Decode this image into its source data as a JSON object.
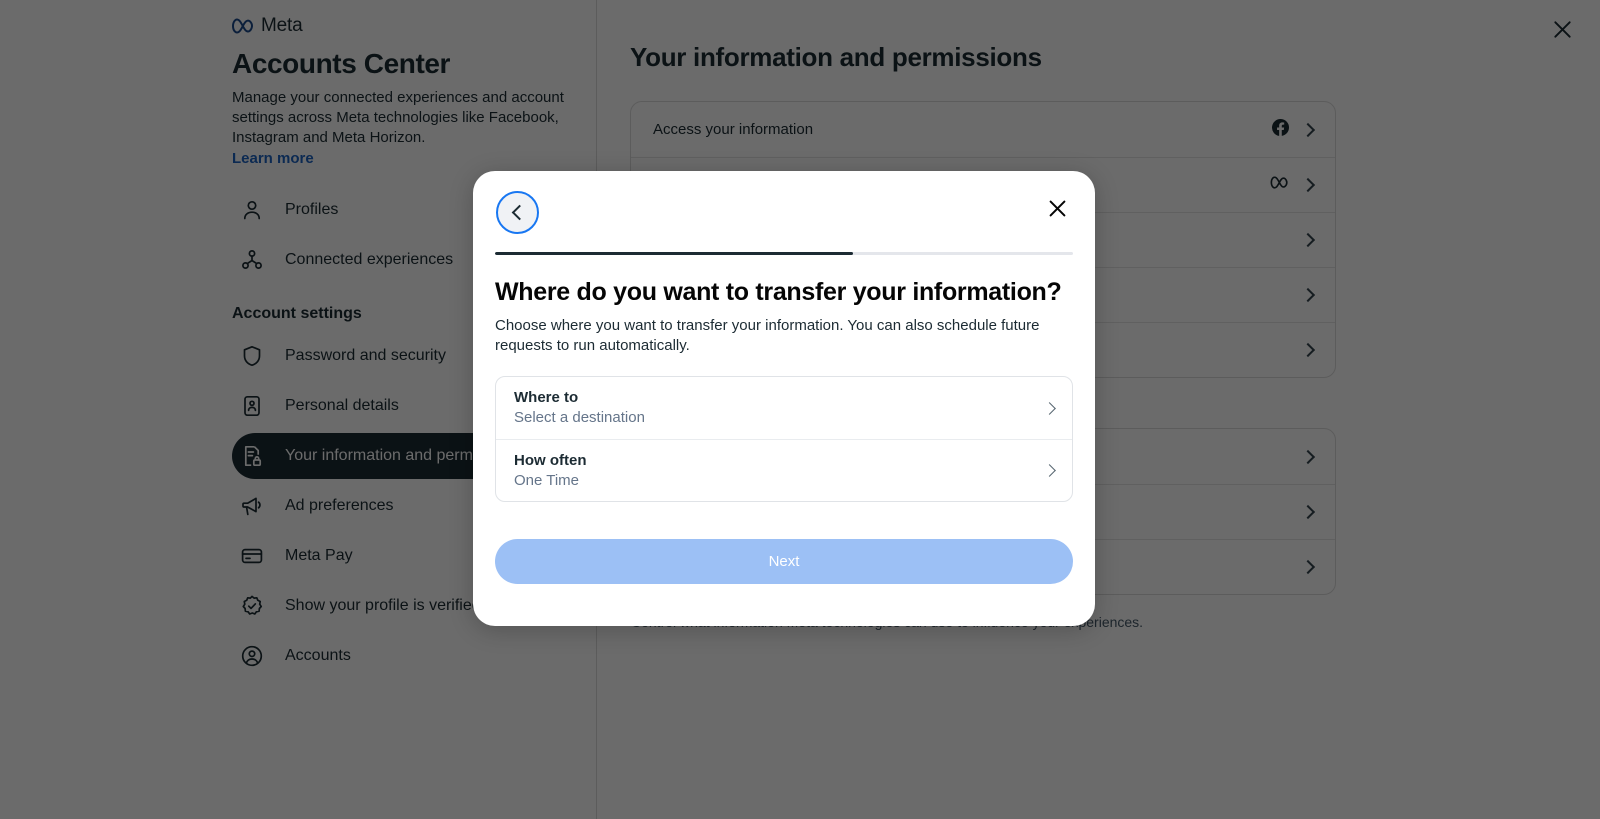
{
  "brand": {
    "wordmark": "Meta",
    "logo_icon": "meta-infinity-icon"
  },
  "sidebar": {
    "title": "Accounts Center",
    "description": "Manage your connected experiences and account settings across Meta technologies like Facebook, Instagram and Meta Horizon.",
    "learn_more": "Learn more",
    "section_title": "Account settings",
    "items": [
      {
        "label": "Profiles",
        "icon": "person-icon",
        "active": false
      },
      {
        "label": "Connected experiences",
        "icon": "connected-nodes-icon",
        "active": false
      }
    ],
    "settings_items": [
      {
        "label": "Password and security",
        "icon": "shield-icon",
        "active": false
      },
      {
        "label": "Personal details",
        "icon": "id-card-icon",
        "active": false
      },
      {
        "label": "Your information and permissions",
        "icon": "document-lock-icon",
        "active": true
      },
      {
        "label": "Ad preferences",
        "icon": "megaphone-icon",
        "active": false
      },
      {
        "label": "Meta Pay",
        "icon": "credit-card-icon",
        "active": false
      },
      {
        "label": "Show your profile is verified",
        "icon": "verified-badge-icon",
        "active": false
      },
      {
        "label": "Accounts",
        "icon": "account-circle-icon",
        "active": false
      }
    ]
  },
  "content": {
    "title": "Your information and permissions",
    "cards": [
      {
        "rows": [
          {
            "label": "Access your information",
            "badge_icon": "facebook-icon"
          },
          {
            "label": "",
            "badge_icon": "meta-infinity-icon"
          },
          {
            "label": "",
            "badge_icon": ""
          },
          {
            "label": "",
            "badge_icon": ""
          },
          {
            "label": "",
            "badge_icon": ""
          }
        ]
      },
      {
        "rows": [
          {
            "label": "",
            "badge_icon": ""
          },
          {
            "label": "",
            "badge_icon": ""
          },
          {
            "label": "",
            "badge_icon": ""
          }
        ],
        "caption": "Control what information Meta technologies can use to influence your experiences."
      }
    ],
    "close_icon": "close-icon"
  },
  "modal": {
    "back_icon": "chevron-left-icon",
    "close_icon": "close-icon",
    "progress_percent": 62,
    "heading": "Where do you want to transfer your information?",
    "subtitle": "Choose where you want to transfer your information. You can also schedule future requests to run automatically.",
    "options": [
      {
        "title": "Where to",
        "value": "Select a destination",
        "chevron_icon": "chevron-right-icon"
      },
      {
        "title": "How often",
        "value": "One Time",
        "chevron_icon": "chevron-right-icon"
      }
    ],
    "next_label": "Next"
  },
  "colors": {
    "meta_blue": "#1877f2",
    "link_blue": "#1d64c4",
    "active_pill": "#1c2b33",
    "next_disabled": "#9cc0f5",
    "text_primary": "#1c2b33",
    "text_muted": "#65758a"
  }
}
